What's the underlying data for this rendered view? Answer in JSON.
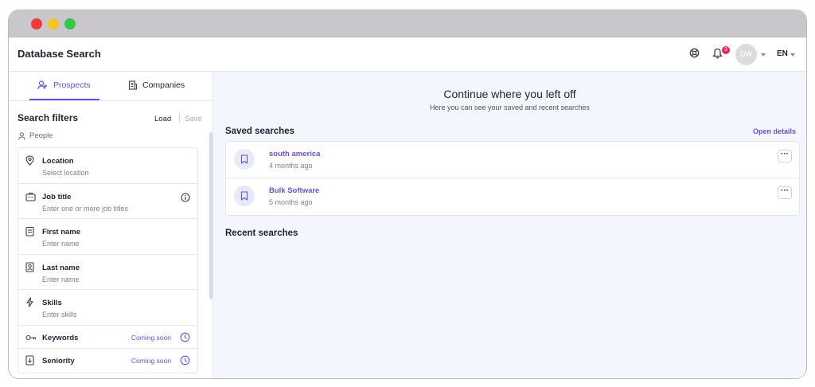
{
  "app": {
    "title": "Database Search"
  },
  "header": {
    "notification_count": "3",
    "avatar_initials": "DW",
    "language": "EN"
  },
  "sidebar": {
    "tabs": [
      {
        "label": "Prospects",
        "active": true
      },
      {
        "label": "Companies",
        "active": false
      }
    ],
    "filters_title": "Search filters",
    "load_label": "Load",
    "save_label": "Save",
    "section_label": "People",
    "filters": [
      {
        "label": "Location",
        "placeholder": "Select location",
        "icon": "location-pin-icon"
      },
      {
        "label": "Job title",
        "placeholder": "Enter one or more job titles",
        "icon": "briefcase-icon"
      },
      {
        "label": "First name",
        "placeholder": "Enter name",
        "icon": "document-icon"
      },
      {
        "label": "Last name",
        "placeholder": "Enter name",
        "icon": "id-card-icon"
      },
      {
        "label": "Skills",
        "placeholder": "Enter skills",
        "icon": "lightning-icon"
      },
      {
        "label": "Keywords",
        "badge": "Coming soon",
        "icon": "key-icon"
      },
      {
        "label": "Seniority",
        "badge": "Coming soon",
        "icon": "seniority-icon"
      }
    ]
  },
  "main": {
    "title": "Continue where you left off",
    "subtitle": "Here you can see your saved and recent searches",
    "saved_title": "Saved searches",
    "open_details": "Open details",
    "saved_searches": [
      {
        "name": "south america",
        "time": "4 months ago"
      },
      {
        "name": "Bulk Software",
        "time": "5 months ago"
      }
    ],
    "recent_title": "Recent searches"
  },
  "colors": {
    "accent": "#6c4fd6",
    "badge": "#e5245b",
    "background": "#f3f6fc"
  }
}
